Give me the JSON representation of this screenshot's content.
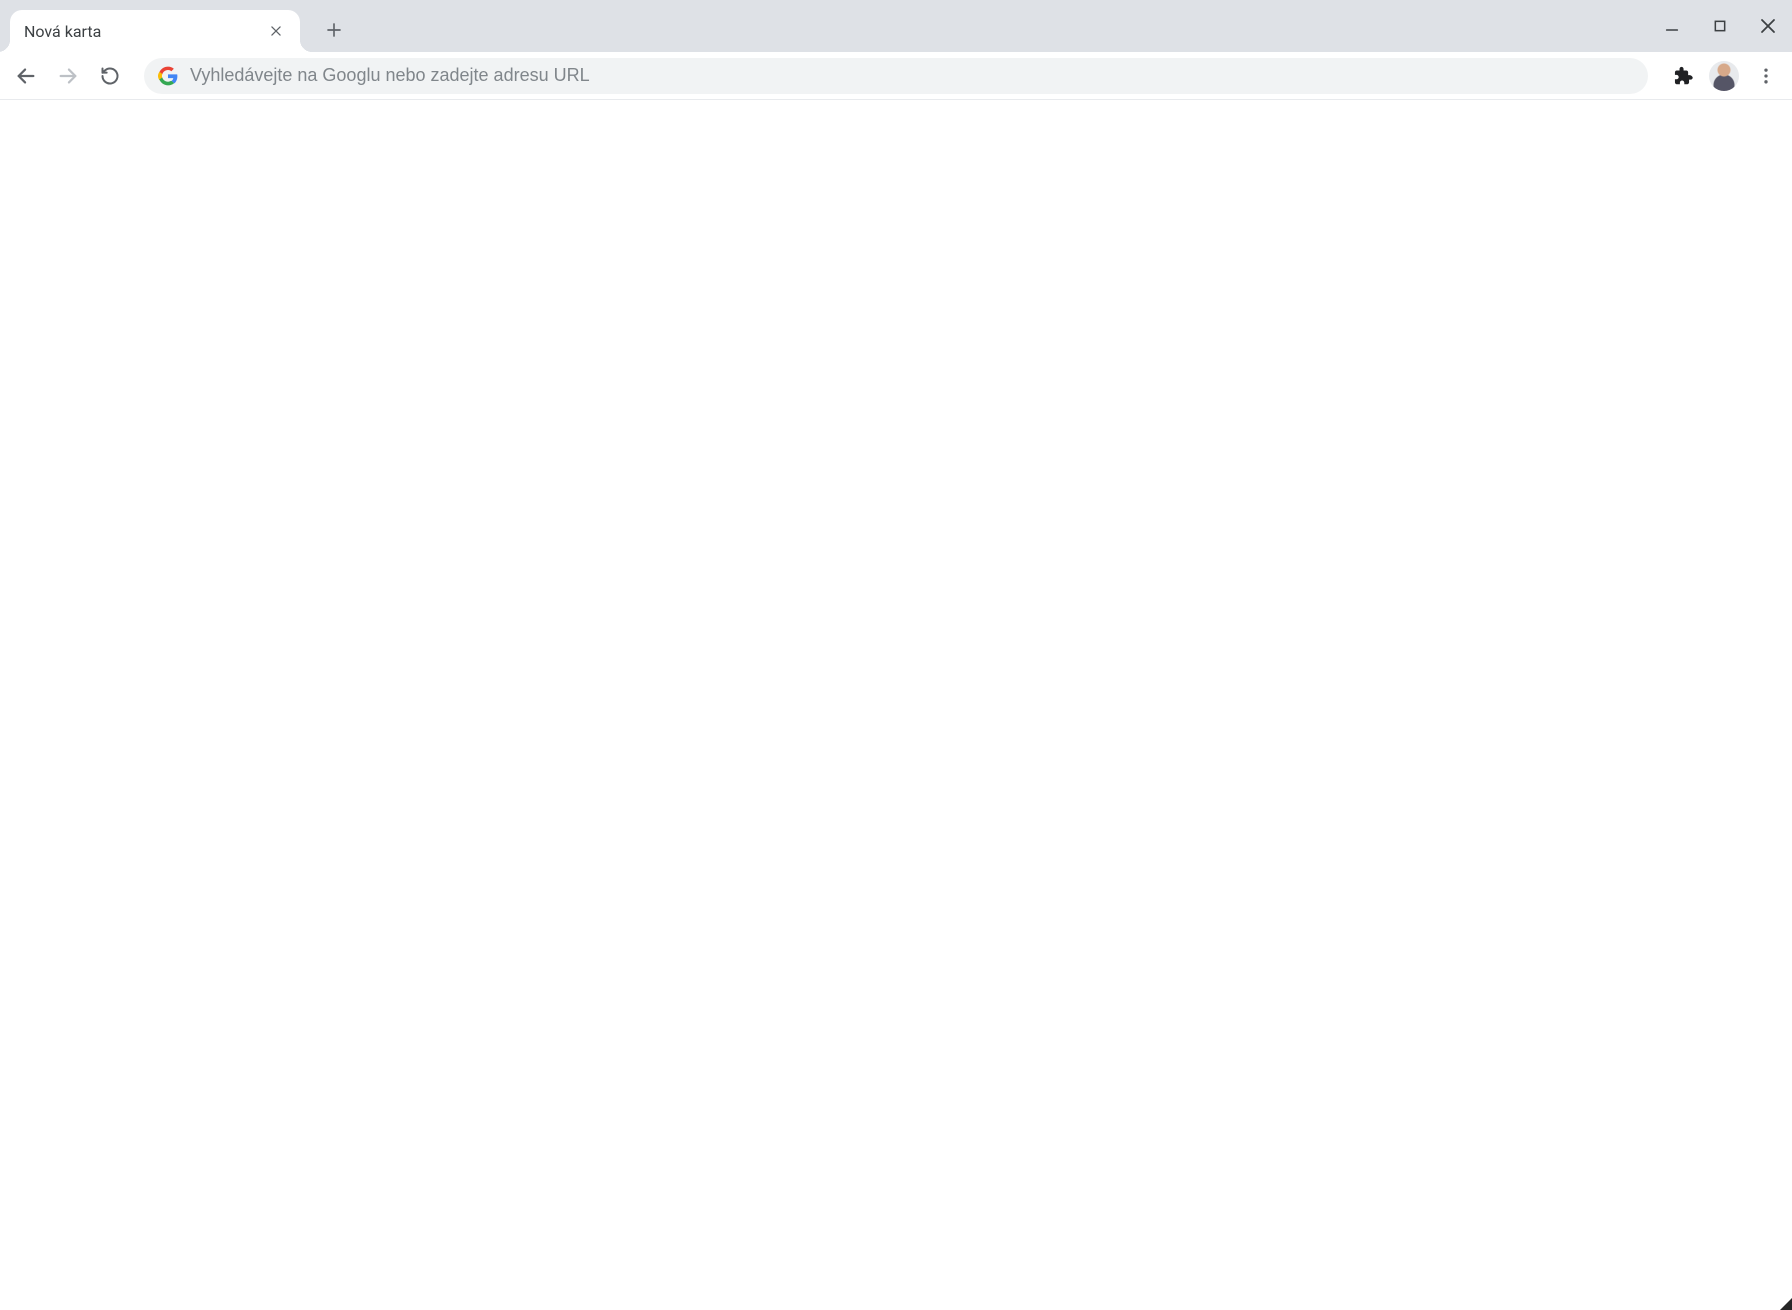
{
  "tab": {
    "title": "Nová karta"
  },
  "omnibox": {
    "placeholder": "Vyhledávejte na Googlu nebo zadejte adresu URL",
    "value": ""
  }
}
